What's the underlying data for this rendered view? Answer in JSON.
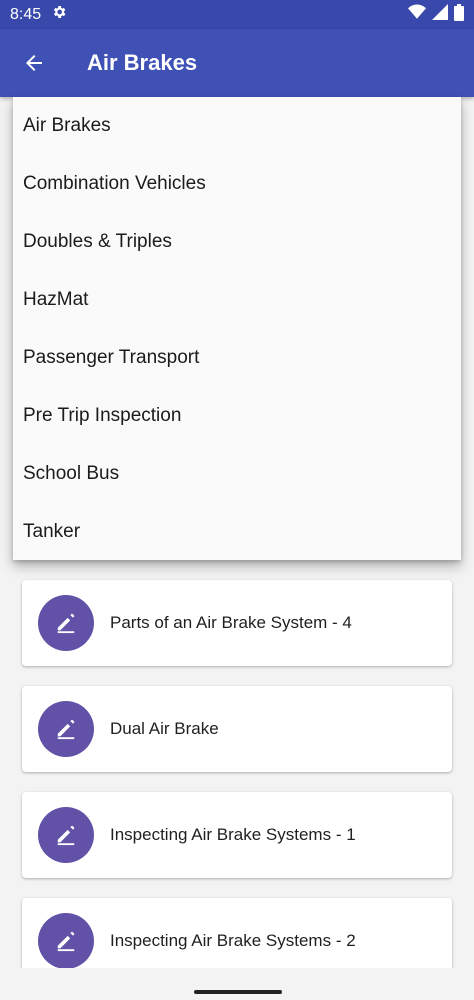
{
  "status_bar": {
    "time": "8:45",
    "icons": [
      "gear-icon",
      "wifi-icon",
      "signal-icon",
      "battery-icon"
    ]
  },
  "app_bar": {
    "title": "Air Brakes",
    "back_icon": "arrow-back-icon"
  },
  "menu": {
    "items": [
      {
        "label": "Air Brakes"
      },
      {
        "label": "Combination Vehicles"
      },
      {
        "label": "Doubles & Triples"
      },
      {
        "label": "HazMat"
      },
      {
        "label": "Passenger Transport"
      },
      {
        "label": "Pre Trip Inspection"
      },
      {
        "label": "School Bus"
      },
      {
        "label": "Tanker"
      }
    ]
  },
  "list": {
    "items": [
      {
        "label": "Parts of an Air Brake System - 4",
        "icon": "edit-icon"
      },
      {
        "label": "Dual Air Brake",
        "icon": "edit-icon"
      },
      {
        "label": "Inspecting Air Brake Systems - 1",
        "icon": "edit-icon"
      },
      {
        "label": "Inspecting Air Brake Systems - 2",
        "icon": "edit-icon"
      }
    ]
  },
  "colors": {
    "status_bar": "#3949ab",
    "app_bar": "#3f51b5",
    "avatar": "#6152a7"
  }
}
